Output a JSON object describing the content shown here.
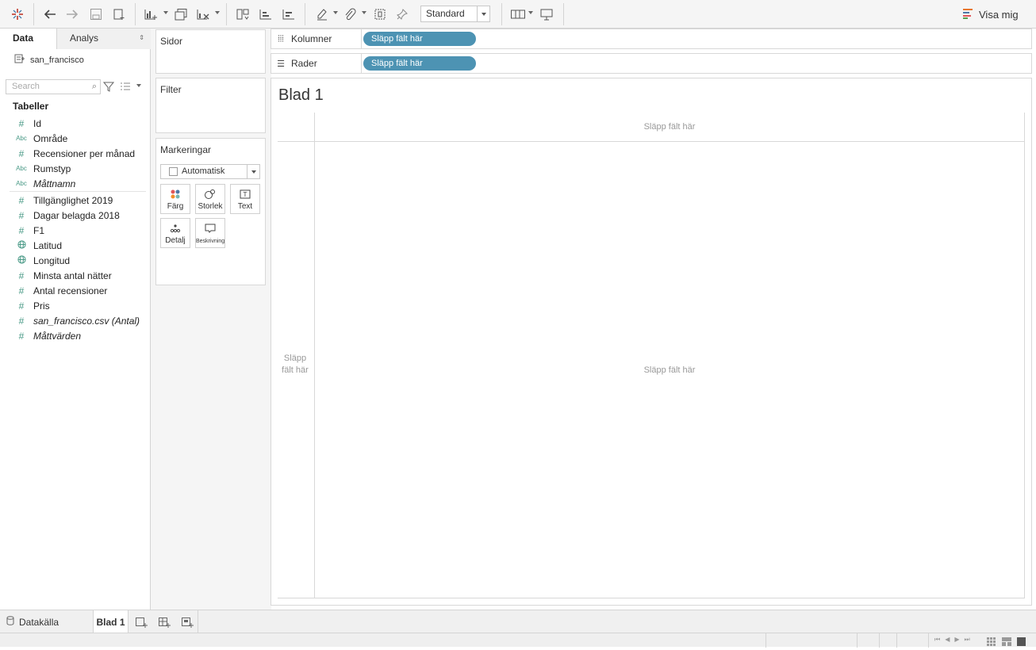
{
  "toolbar": {
    "mark_type_value": "Standard",
    "show_me_label": "Visa mig"
  },
  "sidebar": {
    "tabs": [
      "Data",
      "Analys"
    ],
    "datasource": "san_francisco",
    "search_placeholder": "Search",
    "section_title": "Tabeller",
    "fields": [
      {
        "name": "Id",
        "type": "measure"
      },
      {
        "name": "Område",
        "type": "dimension"
      },
      {
        "name": "Recensioner per månad",
        "type": "measure"
      },
      {
        "name": "Rumstyp",
        "type": "dimension"
      },
      {
        "name": "Måttnamn",
        "type": "dimension"
      },
      {
        "name": "Tillgänglighet 2019",
        "type": "measure"
      },
      {
        "name": "Dagar belagda 2018",
        "type": "measure"
      },
      {
        "name": "F1",
        "type": "measure"
      },
      {
        "name": "Latitud",
        "type": "geo"
      },
      {
        "name": "Longitud",
        "type": "geo"
      },
      {
        "name": "Minsta antal nätter",
        "type": "measure"
      },
      {
        "name": "Antal recensioner",
        "type": "measure"
      },
      {
        "name": "Pris",
        "type": "measure"
      },
      {
        "name": "san_francisco.csv (Antal)",
        "type": "measure"
      },
      {
        "name": "Måttvärden",
        "type": "measure"
      }
    ]
  },
  "cards": {
    "pages_title": "Sidor",
    "filters_title": "Filter",
    "marks_title": "Markeringar",
    "marks_type": "Automatisk",
    "mark_buttons": [
      "Färg",
      "Storlek",
      "Text",
      "Detalj",
      "Beskrivning"
    ]
  },
  "shelves": {
    "columns_label": "Kolumner",
    "rows_label": "Rader",
    "pill_text": "Släpp fält här"
  },
  "viz": {
    "title": "Blad 1",
    "drop_top": "Släpp fält här",
    "drop_left": "Släpp fält här",
    "drop_center": "Släpp fält här"
  },
  "bottom_tabs": {
    "datasource": "Datakälla",
    "sheet": "Blad 1"
  }
}
